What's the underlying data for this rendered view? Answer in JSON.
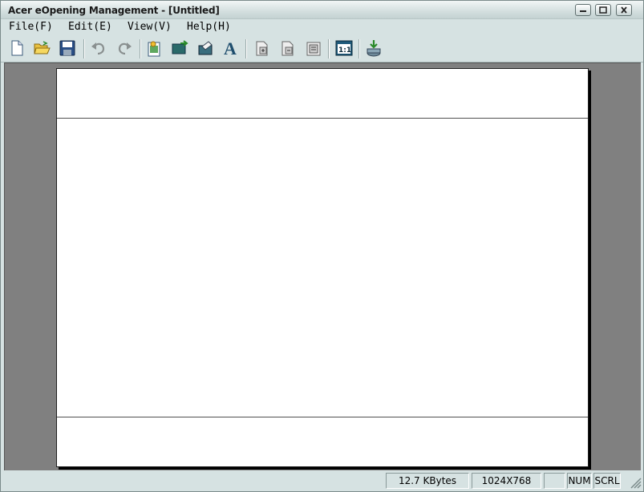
{
  "window": {
    "title": "Acer eOpening Management - [Untitled]"
  },
  "menu": [
    "File(F)",
    "Edit(E)",
    "View(V)",
    "Help(H)"
  ],
  "toolbar": {
    "icons": [
      "new-file-icon",
      "open-folder-icon",
      "save-icon",
      "undo-icon",
      "redo-icon",
      "import-image-icon",
      "export-icon",
      "insert-picture-icon",
      "text-icon",
      "add-page-icon",
      "remove-page-icon",
      "page-properties-icon",
      "actual-size-icon",
      "install-icon"
    ],
    "actual_size_label": "1:1",
    "text_tool_label": "A"
  },
  "status": {
    "filesize": "12.7 KBytes",
    "resolution": "1024X768",
    "blank": "",
    "num": "NUM",
    "scrl": "SCRL"
  },
  "colors": {
    "chrome": "#d6e2e2",
    "workspace": "#808080",
    "page": "#ffffff"
  }
}
